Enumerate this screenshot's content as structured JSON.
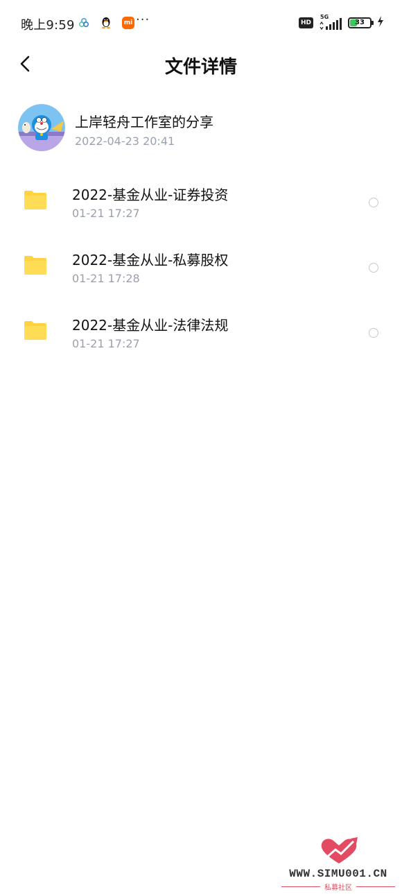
{
  "status_bar": {
    "time": "晚上9:59",
    "more": "···",
    "hd": "HD",
    "network": "5G",
    "battery_level": "33",
    "mi_label": "mi",
    "icons": [
      "pinwheel-icon",
      "qq-penguin-icon",
      "mi-app-icon",
      "hd-icon",
      "signal-icon",
      "battery-icon",
      "charging-icon"
    ],
    "battery_color": "#3cc95a"
  },
  "header": {
    "title": "文件详情",
    "back_icon": "chevron-left-icon"
  },
  "share": {
    "title": "上岸轻舟工作室的分享",
    "time": "2022-04-23  20:41"
  },
  "files": [
    {
      "name": "2022-基金从业-证券投资",
      "time": "01-21  17:27",
      "icon": "folder-icon"
    },
    {
      "name": "2022-基金从业-私募股权",
      "time": "01-21  17:28",
      "icon": "folder-icon"
    },
    {
      "name": "2022-基金从业-法律法规",
      "time": "01-21  17:27",
      "icon": "folder-icon"
    }
  ],
  "watermark": {
    "text": "WWW.SIMU001.CN",
    "sub": "私募社区"
  },
  "colors": {
    "folder": "#ffd23f",
    "secondary_text": "#9aa0ad",
    "watermark_accent": "#e34b63"
  }
}
